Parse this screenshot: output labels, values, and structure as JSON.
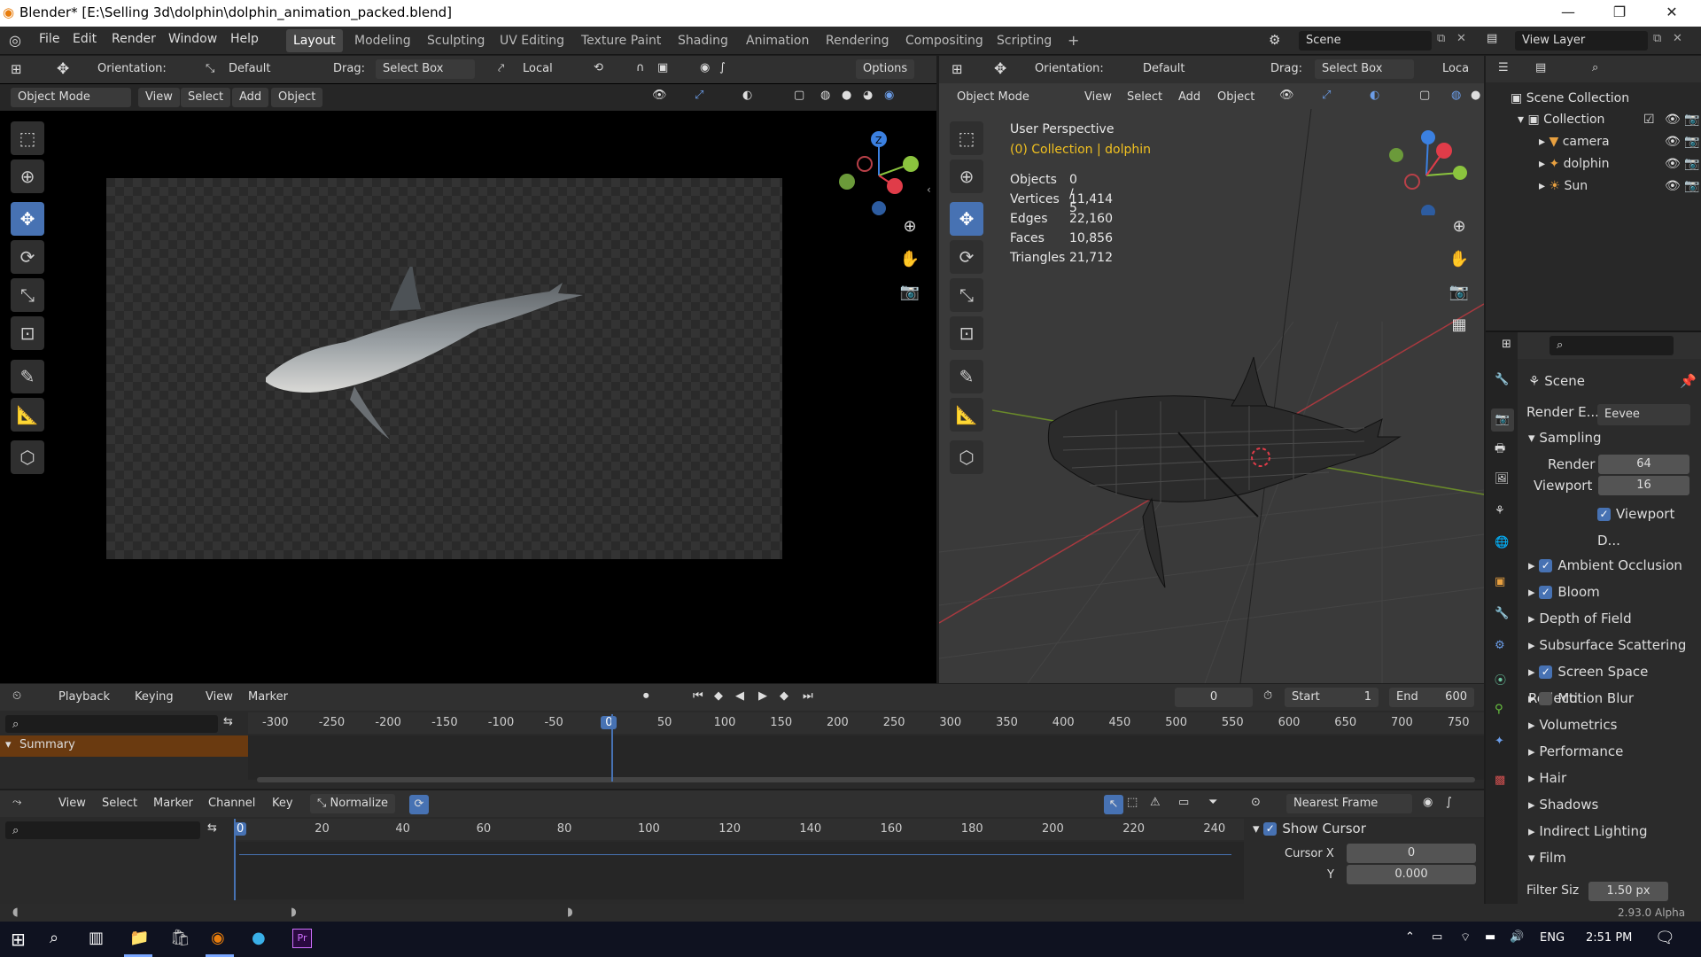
{
  "window": {
    "title": "Blender* [E:\\Selling 3d\\dolphin\\dolphin_animation_packed.blend]",
    "min": "—",
    "max": "❐",
    "close": "✕"
  },
  "menus": [
    "File",
    "Edit",
    "Render",
    "Window",
    "Help"
  ],
  "workspaces": [
    "Layout",
    "Modeling",
    "Sculpting",
    "UV Editing",
    "Texture Paint",
    "Shading",
    "Animation",
    "Rendering",
    "Compositing",
    "Scripting"
  ],
  "add_workspace": "+",
  "scene": {
    "name": "Scene",
    "view_layer": "View Layer"
  },
  "header_left": {
    "orientation_label": "Orientation:",
    "orientation": "Default",
    "drag_label": "Drag:",
    "drag": "Select Box",
    "pivot": "Local",
    "options": "Options"
  },
  "header_right": {
    "orientation_label": "Orientation:",
    "orientation": "Default",
    "drag_label": "Drag:",
    "drag": "Select Box",
    "pivot": "Loca"
  },
  "viewport_menus": {
    "mode": "Object Mode",
    "view": "View",
    "select": "Select",
    "add": "Add",
    "object": "Object"
  },
  "overlay": {
    "perspective": "User Perspective",
    "collection": "(0) Collection | dolphin",
    "stats": [
      {
        "k": "Objects",
        "v": "0 / 5"
      },
      {
        "k": "Vertices",
        "v": "11,414"
      },
      {
        "k": "Edges",
        "v": "22,160"
      },
      {
        "k": "Faces",
        "v": "10,856"
      },
      {
        "k": "Triangles",
        "v": "21,712"
      }
    ]
  },
  "gizmo": {
    "x": "X",
    "y": "Y",
    "z": "Z"
  },
  "outliner": {
    "root": "Scene Collection",
    "collection": "Collection",
    "items": [
      "camera",
      "dolphin",
      "Sun"
    ]
  },
  "properties": {
    "scene": "Scene",
    "render_engine_label": "Render E...",
    "render_engine": "Eevee",
    "sampling": "Sampling",
    "render_label": "Render",
    "render_val": "64",
    "viewport_label": "Viewport",
    "viewport_val": "16",
    "viewport_denoise": "Viewport D...",
    "panels": [
      {
        "label": "Ambient Occlusion",
        "check": true
      },
      {
        "label": "Bloom",
        "check": true
      },
      {
        "label": "Depth of Field",
        "check": null
      },
      {
        "label": "Subsurface Scattering",
        "check": null
      },
      {
        "label": "Screen Space Reflecti",
        "check": true
      },
      {
        "label": "Motion Blur",
        "check": false
      },
      {
        "label": "Volumetrics",
        "check": null
      },
      {
        "label": "Performance",
        "check": null
      },
      {
        "label": "Hair",
        "check": null
      },
      {
        "label": "Shadows",
        "check": null
      },
      {
        "label": "Indirect Lighting",
        "check": null
      },
      {
        "label": "Film",
        "check": null
      }
    ],
    "filter_label": "Filter Siz",
    "filter_val": "1.50 px"
  },
  "timeline": {
    "playback": "Playback",
    "keying": "Keying",
    "view": "View",
    "marker": "Marker",
    "frame": "0",
    "start_label": "Start",
    "start": "1",
    "end_label": "End",
    "end": "600",
    "ticks": [
      "-300",
      "-250",
      "-200",
      "-150",
      "-100",
      "-50",
      "0",
      "50",
      "100",
      "150",
      "200",
      "250",
      "300",
      "350",
      "400",
      "450",
      "500",
      "550",
      "600",
      "650",
      "700",
      "750"
    ],
    "summary": "Summary"
  },
  "graph": {
    "view": "View",
    "select": "Select",
    "marker": "Marker",
    "channel": "Channel",
    "key": "Key",
    "normalize": "Normalize",
    "snap": "Nearest Frame",
    "ticks": [
      "0",
      "20",
      "40",
      "60",
      "80",
      "100",
      "120",
      "140",
      "160",
      "180",
      "200",
      "220",
      "240"
    ],
    "show_cursor": "Show Cursor",
    "cursor_x_label": "Cursor X",
    "cursor_x": "0",
    "cursor_y_label": "Y",
    "cursor_y": "0.000"
  },
  "status": {
    "version": "2.93.0 Alpha"
  },
  "taskbar": {
    "lang": "ENG",
    "time": "2:51 PM"
  }
}
